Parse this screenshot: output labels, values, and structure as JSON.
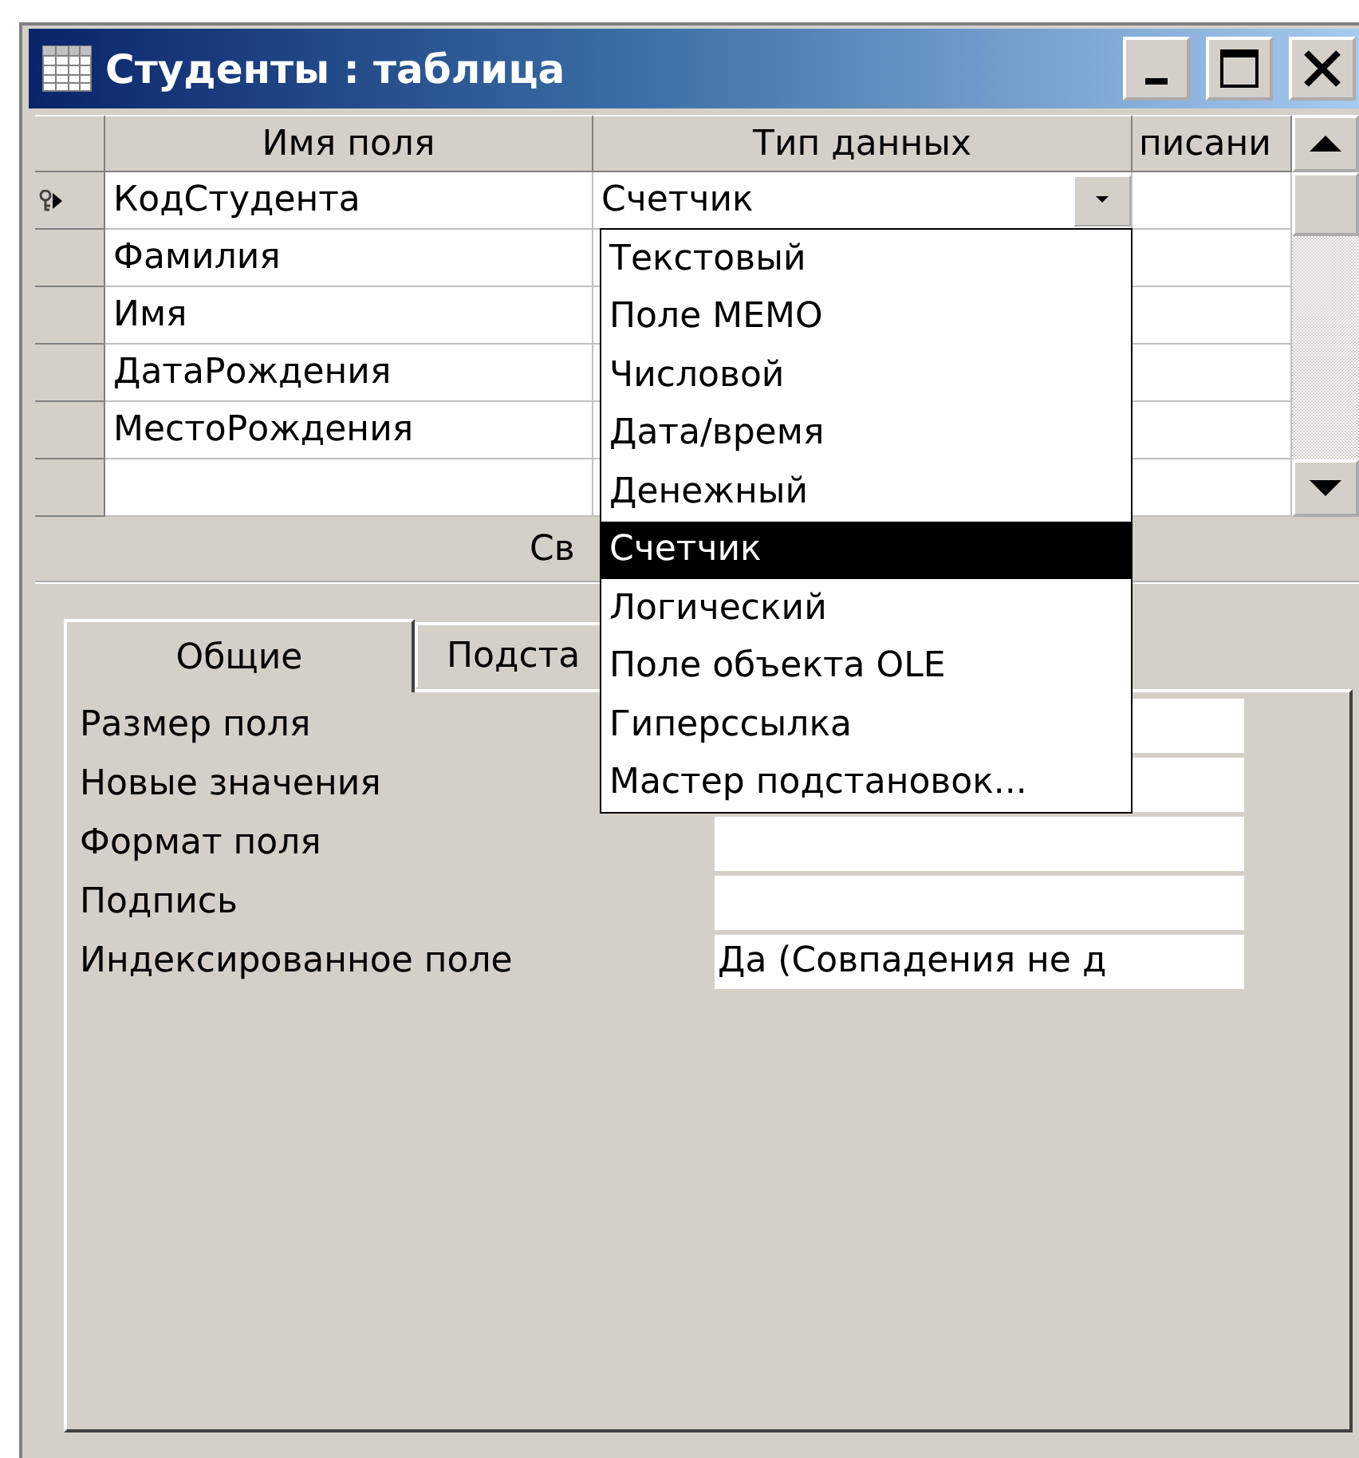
{
  "window": {
    "title": "Студенты : таблица"
  },
  "grid": {
    "columns": [
      "Имя поля",
      "Тип данных",
      "писани"
    ],
    "rows": [
      {
        "field": "КодСтудента",
        "type": "Счетчик",
        "selected": true,
        "primary_key": true
      },
      {
        "field": "Фамилия",
        "selected": false,
        "primary_key": false
      },
      {
        "field": "Имя",
        "selected": false,
        "primary_key": false
      },
      {
        "field": "ДатаРождения",
        "selected": false,
        "primary_key": false
      },
      {
        "field": "МестоРождения",
        "selected": false,
        "primary_key": false
      }
    ]
  },
  "dropdown": {
    "items": [
      {
        "label": "Текстовый",
        "selected": false
      },
      {
        "label": "Поле MEMO",
        "selected": false
      },
      {
        "label": "Числовой",
        "selected": false
      },
      {
        "label": "Дата/время",
        "selected": false
      },
      {
        "label": "Денежный",
        "selected": false
      },
      {
        "label": "Счетчик",
        "selected": true
      },
      {
        "label": "Логический",
        "selected": false
      },
      {
        "label": "Поле объекта OLE",
        "selected": false
      },
      {
        "label": "Гиперссылка",
        "selected": false
      },
      {
        "label": "Мастер подстановок...",
        "selected": false
      }
    ]
  },
  "properties": {
    "section_label": "Св",
    "tabs": [
      {
        "label": "Общие",
        "selected": true
      },
      {
        "label": "Подста",
        "selected": false
      }
    ],
    "rows": [
      {
        "label": "Размер поля"
      },
      {
        "label": "Новые значения"
      },
      {
        "label": "Формат поля"
      },
      {
        "label": "Подпись"
      },
      {
        "label": "Индексированное поле",
        "value": "Да (Совпадения не д"
      }
    ]
  }
}
